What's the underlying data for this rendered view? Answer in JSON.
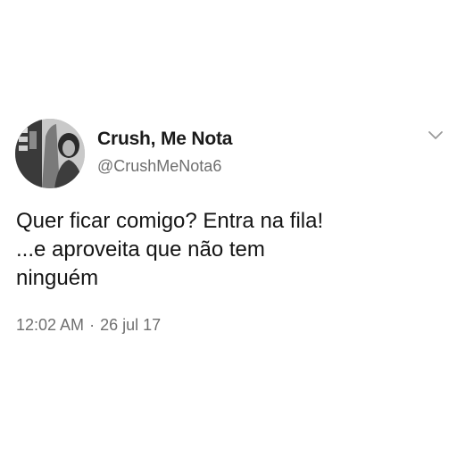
{
  "author": {
    "display_name": "Crush, Me Nota",
    "handle": "@CrushMeNota6"
  },
  "tweet": {
    "lines": [
      "Quer ficar comigo? Entra na fila!",
      "...e aproveita que não tem",
      "ninguém"
    ]
  },
  "meta": {
    "time": "12:02 AM",
    "separator": "·",
    "date": "26 jul 17"
  },
  "icons": {
    "avatar": "profile-photo",
    "menu": "chevron-down-icon"
  },
  "colors": {
    "background": "#ffffff",
    "text": "#151515",
    "secondary_text": "#6f6f6f"
  }
}
